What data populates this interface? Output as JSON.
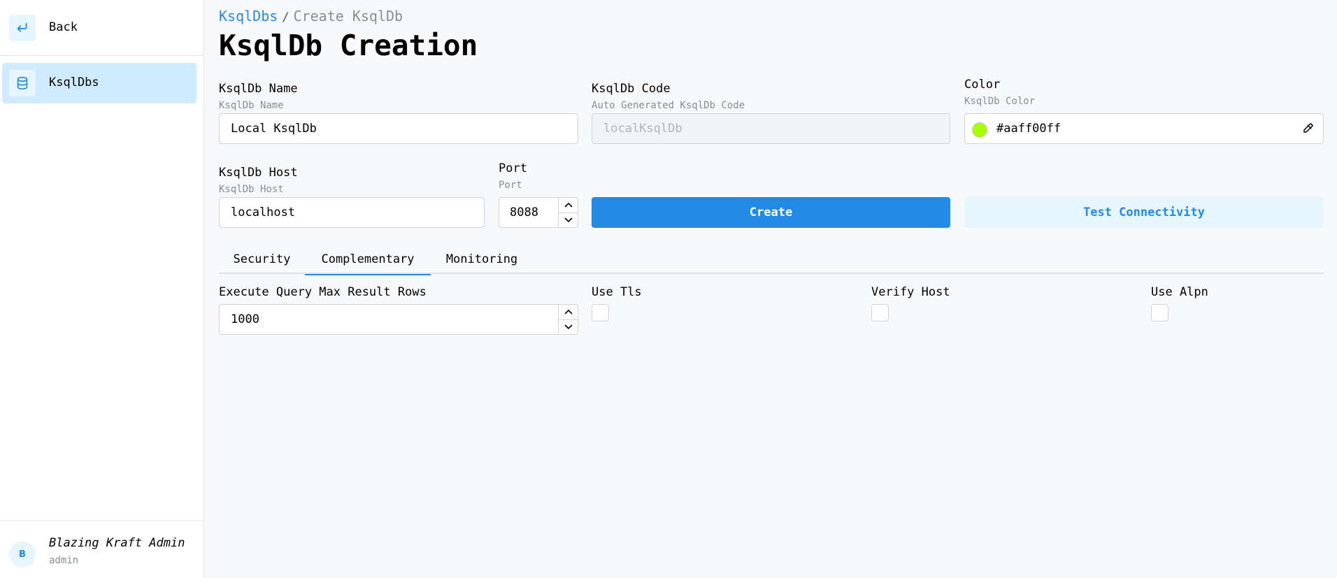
{
  "sidebar": {
    "back_label": "Back",
    "back_icon": "arrow-back-icon",
    "items": [
      {
        "label": "KsqlDbs",
        "icon": "database-icon",
        "active": true
      }
    ],
    "user": {
      "avatar_initial": "B",
      "name": "Blazing Kraft Admin",
      "role": "admin"
    }
  },
  "breadcrumb": {
    "parent": "KsqlDbs",
    "separator": "/",
    "current": "Create KsqlDb"
  },
  "page_title": "KsqlDb Creation",
  "form": {
    "name": {
      "label": "KsqlDb Name",
      "description": "KsqlDb Name",
      "value": "Local KsqlDb"
    },
    "code": {
      "label": "KsqlDb Code",
      "description": "Auto Generated KsqlDb Code",
      "placeholder": "localKsqlDb",
      "disabled": true
    },
    "color": {
      "label": "Color",
      "description": "KsqlDb Color",
      "value": "#aaff00ff",
      "swatch": "#aaff00"
    },
    "host": {
      "label": "KsqlDb Host",
      "description": "KsqlDb Host",
      "value": "localhost"
    },
    "port": {
      "label": "Port",
      "description": "Port",
      "value": "8088"
    }
  },
  "buttons": {
    "create": "Create",
    "test": "Test Connectivity"
  },
  "tabs": [
    {
      "label": "Security",
      "active": false
    },
    {
      "label": "Complementary",
      "active": true
    },
    {
      "label": "Monitoring",
      "active": false
    }
  ],
  "complementary": {
    "max_rows": {
      "label": "Execute Query Max Result Rows",
      "value": "1000"
    },
    "use_tls": {
      "label": "Use Tls",
      "checked": false
    },
    "verify_host": {
      "label": "Verify Host",
      "checked": false
    },
    "use_alpn": {
      "label": "Use Alpn",
      "checked": false
    }
  },
  "colors": {
    "accent": "#228be6",
    "accent_light": "#e7f5ff",
    "active_nav": "#d0ebff"
  }
}
